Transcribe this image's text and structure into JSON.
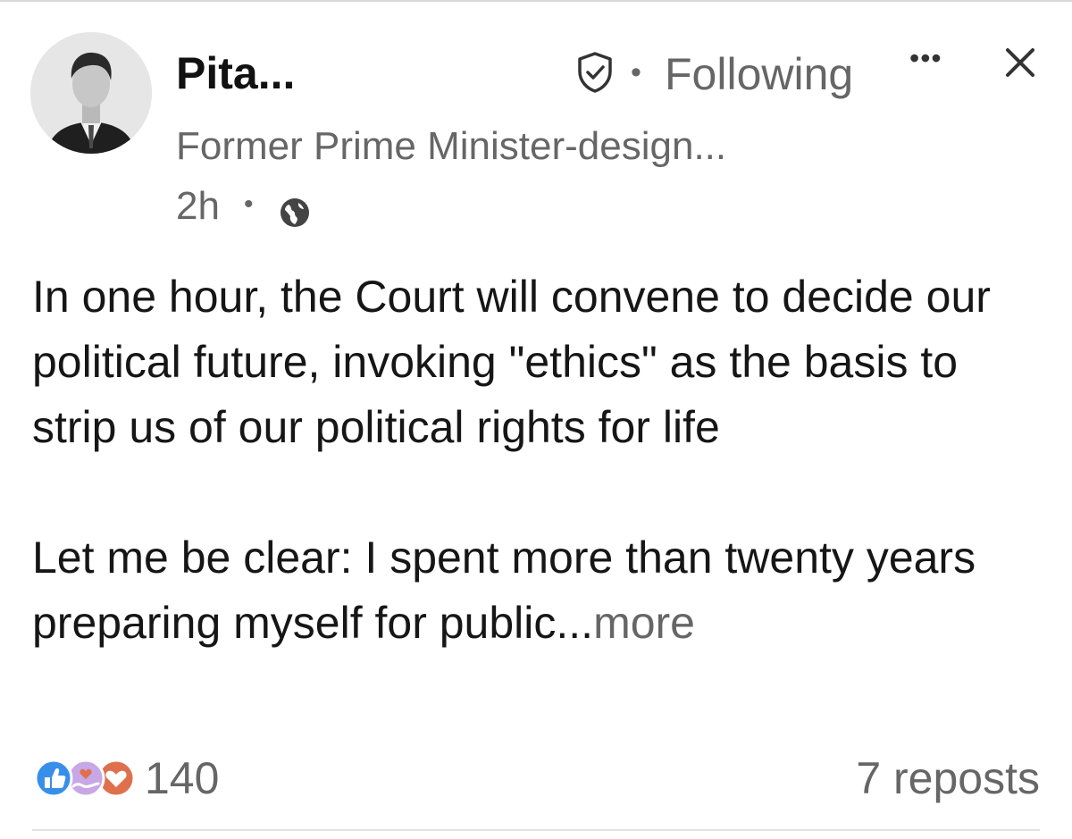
{
  "author": {
    "name": "Pita...",
    "headline": "Former Prime Minister-design...",
    "follow_status": "Following"
  },
  "meta": {
    "time_ago": "2h",
    "separator": "•",
    "visibility_icon": "globe-icon"
  },
  "icons": {
    "verified": "verified-shield-icon",
    "menu": "more-options-icon",
    "close": "close-icon",
    "reactions": [
      "like-icon",
      "support-icon",
      "love-icon"
    ]
  },
  "post": {
    "paragraph_1": "In one hour, the Court will convene to decide our political future, invoking \"ethics\" as the basis to strip us of our political rights for life",
    "paragraph_2": "Let me be clear: I spent more than twenty years preparing myself for public...",
    "see_more": "more"
  },
  "social": {
    "reaction_count": "140",
    "reposts": "7 reposts"
  },
  "colors": {
    "like": "#378fe9",
    "support": "#c7a7e6",
    "love": "#df704d",
    "muted_text": "#666666"
  }
}
